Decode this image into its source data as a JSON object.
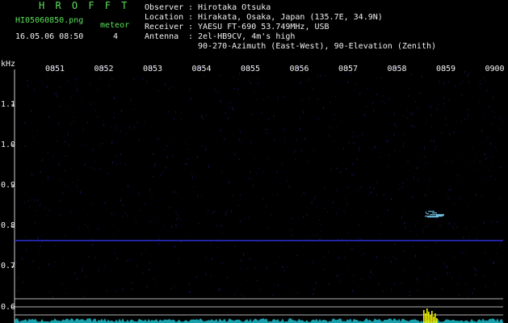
{
  "header": {
    "title": "H R O F F T",
    "filename": "HI05060850.png",
    "datetime": "16.05.06 08:50",
    "meteor_label": "meteor",
    "meteor_count": "4",
    "info": [
      {
        "key": "Observer",
        "sep": ":",
        "value": "Hirotaka Otsuka"
      },
      {
        "key": "Location",
        "sep": ":",
        "value": "Hirakata, Osaka, Japan (135.7E, 34.9N)"
      },
      {
        "key": "Receiver",
        "sep": ":",
        "value": "YAESU FT-690 53.749MHz, USB"
      },
      {
        "key": "Antenna",
        "sep": ":",
        "value": "2el-HB9CV, 4m's high"
      },
      {
        "key": "",
        "sep": "",
        "value": "90-270-Azimuth (East-West), 90-Elevation (Zenith)"
      }
    ]
  },
  "spectrogram": {
    "y_unit": "kHz",
    "time_ticks": [
      "0851",
      "0852",
      "0853",
      "0854",
      "0855",
      "0856",
      "0857",
      "0858",
      "0859",
      "0900"
    ],
    "freq_ticks": [
      "1.1",
      "1.0",
      "0.9",
      "0.8",
      "0.7",
      "0.6"
    ],
    "carrier_freq_khz": 0.765,
    "echo": {
      "time": "08:58.7",
      "freq_khz": 0.83
    },
    "colors": {
      "background": "#000000",
      "noise": "#16165a",
      "carrier": "#2e2ed8",
      "echo": "#7fd8ff",
      "amplitude": "#1ec8d8",
      "burst": "#f0f000",
      "ref_lines": "#d0d0d0"
    }
  }
}
